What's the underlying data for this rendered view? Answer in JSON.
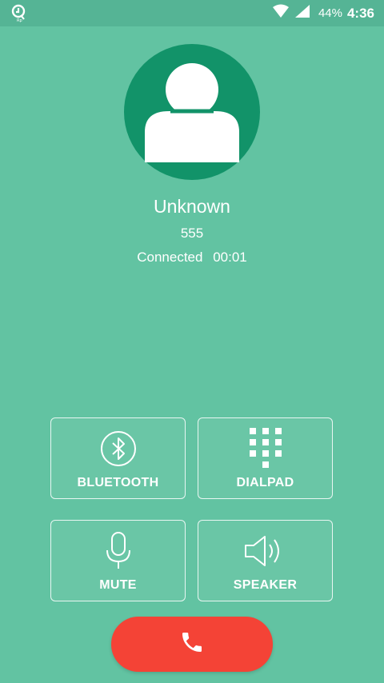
{
  "status_bar": {
    "battery": "44%",
    "time": "4:36",
    "icons": [
      "app-notification-icon",
      "wifi-icon",
      "cellular-signal-icon"
    ]
  },
  "caller": {
    "name": "Unknown",
    "number": "555",
    "state": "Connected",
    "duration": "00:01"
  },
  "controls": {
    "bluetooth": {
      "label": "BLUETOOTH",
      "icon": "bluetooth-icon"
    },
    "dialpad": {
      "label": "DIALPAD",
      "icon": "dialpad-icon"
    },
    "mute": {
      "label": "MUTE",
      "icon": "microphone-icon"
    },
    "speaker": {
      "label": "SPEAKER",
      "icon": "speaker-icon"
    }
  },
  "end_call": {
    "icon": "phone-hangup-icon",
    "color": "#f44336"
  },
  "colors": {
    "background": "#62c3a2",
    "status_bar": "#55b495",
    "avatar": "#129369",
    "end_call": "#f44336"
  }
}
